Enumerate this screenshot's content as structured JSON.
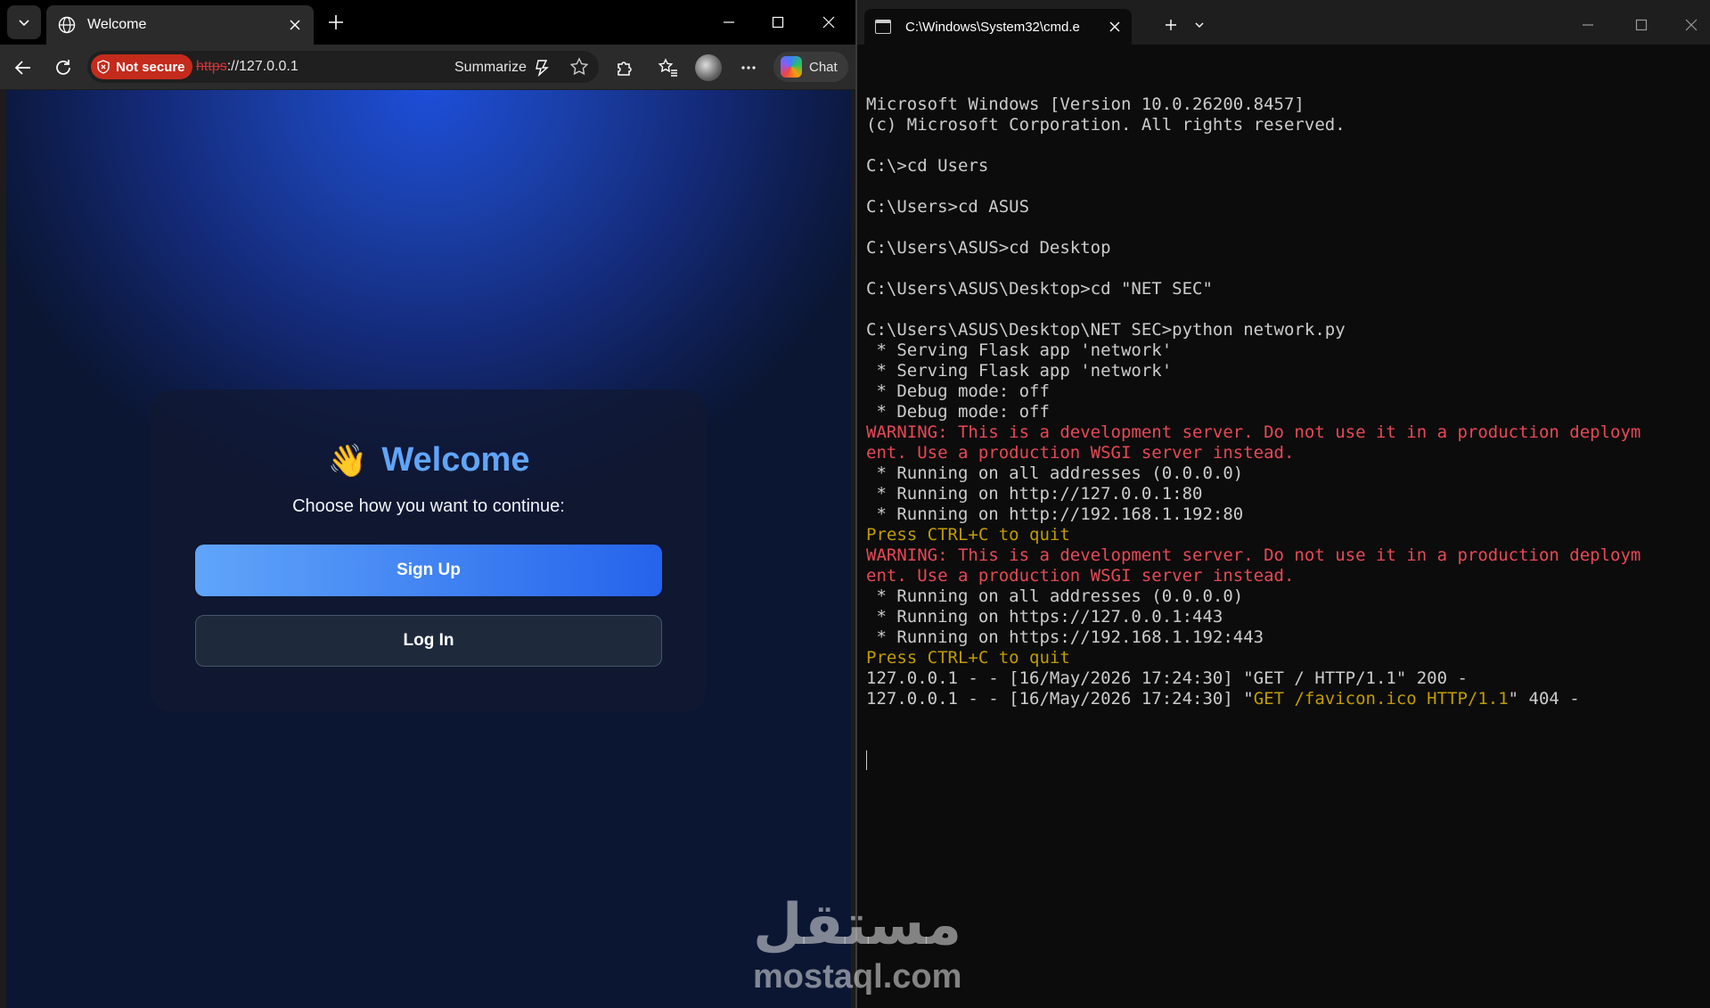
{
  "browser": {
    "tab_title": "Welcome",
    "security_label": "Not secure",
    "url_scheme": "https",
    "url_rest": "://127.0.0.1",
    "summarize_label": "Summarize",
    "chat_label": "Chat"
  },
  "page": {
    "emoji": "👋",
    "title": "Welcome",
    "subtitle": "Choose how you want to continue:",
    "signup_label": "Sign Up",
    "login_label": "Log In"
  },
  "terminal": {
    "tab_title": "C:\\Windows\\System32\\cmd.e",
    "lines": [
      {
        "text": "Microsoft Windows [Version 10.0.26200.8457]",
        "color": "default"
      },
      {
        "text": "(c) Microsoft Corporation. All rights reserved.",
        "color": "default"
      },
      {
        "text": "",
        "color": "default"
      },
      {
        "text": "C:\\>cd Users",
        "color": "default"
      },
      {
        "text": "",
        "color": "default"
      },
      {
        "text": "C:\\Users>cd ASUS",
        "color": "default"
      },
      {
        "text": "",
        "color": "default"
      },
      {
        "text": "C:\\Users\\ASUS>cd Desktop",
        "color": "default"
      },
      {
        "text": "",
        "color": "default"
      },
      {
        "text": "C:\\Users\\ASUS\\Desktop>cd \"NET SEC\"",
        "color": "default"
      },
      {
        "text": "",
        "color": "default"
      },
      {
        "text": "C:\\Users\\ASUS\\Desktop\\NET SEC>python network.py",
        "color": "default"
      },
      {
        "text": " * Serving Flask app 'network'",
        "color": "default"
      },
      {
        "text": " * Serving Flask app 'network'",
        "color": "default"
      },
      {
        "text": " * Debug mode: off",
        "color": "default"
      },
      {
        "text": " * Debug mode: off",
        "color": "default"
      },
      {
        "text": "WARNING: This is a development server. Do not use it in a production deploym",
        "color": "red"
      },
      {
        "text": "ent. Use a production WSGI server instead.",
        "color": "red"
      },
      {
        "text": " * Running on all addresses (0.0.0.0)",
        "color": "default"
      },
      {
        "text": " * Running on http://127.0.0.1:80",
        "color": "default"
      },
      {
        "text": " * Running on http://192.168.1.192:80",
        "color": "default"
      },
      {
        "text": "Press CTRL+C to quit",
        "color": "yellow"
      },
      {
        "text": "WARNING: This is a development server. Do not use it in a production deploym",
        "color": "red"
      },
      {
        "text": "ent. Use a production WSGI server instead.",
        "color": "red"
      },
      {
        "text": " * Running on all addresses (0.0.0.0)",
        "color": "default"
      },
      {
        "text": " * Running on https://127.0.0.1:443",
        "color": "default"
      },
      {
        "text": " * Running on https://192.168.1.192:443",
        "color": "default"
      },
      {
        "text": "Press CTRL+C to quit",
        "color": "yellow"
      },
      {
        "text": "127.0.0.1 - - [16/May/2026 17:24:30] \"GET / HTTP/1.1\" 200 -",
        "color": "default"
      }
    ],
    "last_line": {
      "prefix": "127.0.0.1 - - [16/May/2026 17:24:30] \"",
      "highlight": "GET /favicon.ico HTTP/1.1",
      "suffix": "\" 404 -"
    }
  },
  "watermark": {
    "arabic": "مستقل",
    "latin": "mostaql.com"
  }
}
